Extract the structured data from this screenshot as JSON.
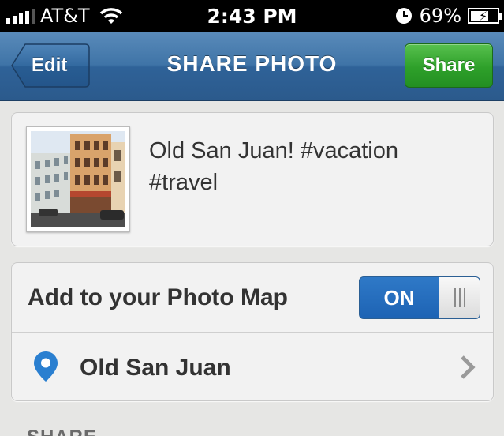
{
  "status_bar": {
    "carrier": "AT&T",
    "time": "2:43 PM",
    "battery_percent": "69%",
    "icons": [
      "signal-icon",
      "wifi-icon",
      "clock-icon",
      "battery-icon"
    ]
  },
  "nav": {
    "back_label": "Edit",
    "title": "SHARE PHOTO",
    "share_label": "Share",
    "colors": {
      "bar": "#3f74a7",
      "share_button": "#2ea02a"
    }
  },
  "post": {
    "caption": "Old San Juan! #vacation #travel",
    "thumbnail_icon": "photo-thumbnail"
  },
  "photo_map": {
    "label": "Add to your Photo Map",
    "toggle_state": "ON",
    "location_name": "Old San Juan",
    "location_icon": "map-pin-icon",
    "accent_color": "#1d63b4"
  },
  "share_section": {
    "header": "SHARE"
  }
}
